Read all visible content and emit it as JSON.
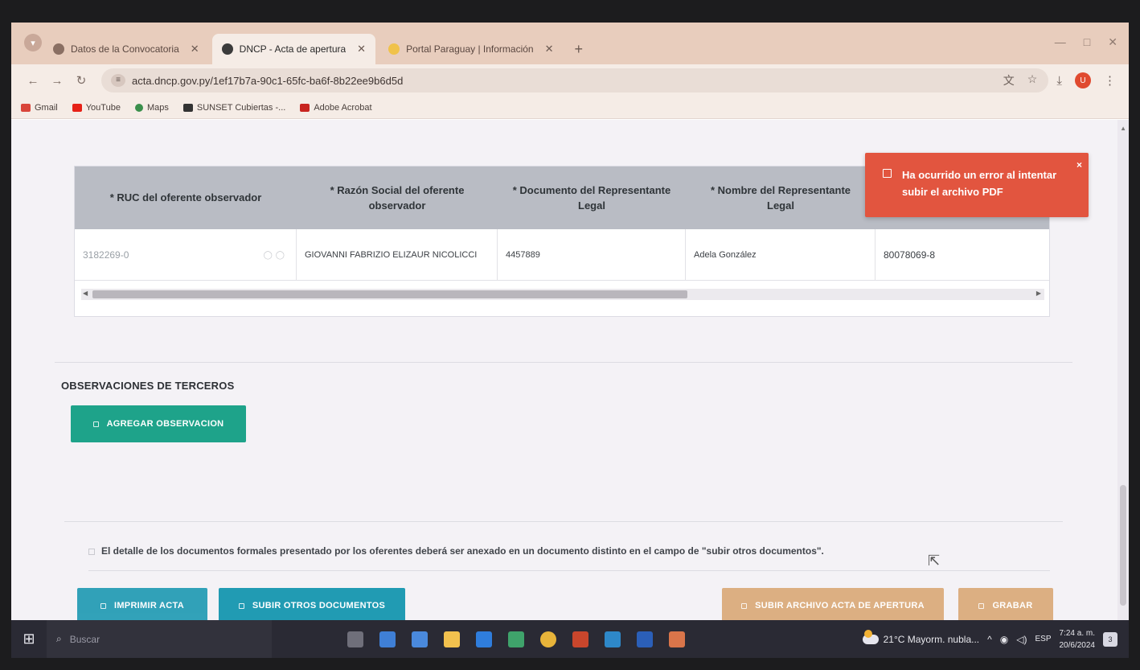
{
  "browser": {
    "tabs": [
      {
        "label": "Datos de la Convocatoria",
        "active": false
      },
      {
        "label": "DNCP - Acta de apertura",
        "active": true
      },
      {
        "label": "Portal Paraguay | Información",
        "active": false
      }
    ],
    "new_tab": "+",
    "url": "acta.dncp.gov.py/1ef17b7a-90c1-65fc-ba6f-8b22ee9b6d5d",
    "profile_initial": "U",
    "bookmarks": [
      "Gmail",
      "YouTube",
      "Maps",
      "SUNSET Cubiertas -...",
      "Adobe Acrobat"
    ]
  },
  "table": {
    "headers": [
      "* RUC del oferente observador",
      "* Razón Social del oferente observador",
      "* Documento del Representante Legal",
      "* Nombre del Representante Legal",
      ""
    ],
    "row": [
      "3182269-0",
      "GIOVANNI FABRIZIO ELIZAUR NICOLICCI",
      "4457889",
      "Adela González",
      "80078069-8"
    ]
  },
  "toast": {
    "message": "Ha ocurrido un error al intentar subir el archivo PDF",
    "close": "×"
  },
  "observaciones": {
    "title": "OBSERVACIONES DE TERCEROS",
    "add_button": "AGREGAR OBSERVACION"
  },
  "note": "El detalle de los documentos formales presentado por los oferentes deberá ser anexado en un documento distinto en el campo de \"subir otros documentos\".",
  "actions": {
    "print": "IMPRIMIR ACTA",
    "upload_other": "SUBIR OTROS DOCUMENTOS",
    "upload_acta": "SUBIR ARCHIVO ACTA DE APERTURA",
    "save": "GRABAR"
  },
  "taskbar": {
    "search_placeholder": "Buscar",
    "weather": "21°C  Mayorm. nubla...",
    "language": "ESP",
    "time": "7:24 a. m.",
    "date": "20/6/2024",
    "notifications": "3"
  },
  "colors": {
    "toast": "#e2553f",
    "teal": "#1ea38a",
    "cyan": "#219bb3",
    "tan": "#dcaf82",
    "table_header": "#b9bcc4"
  }
}
